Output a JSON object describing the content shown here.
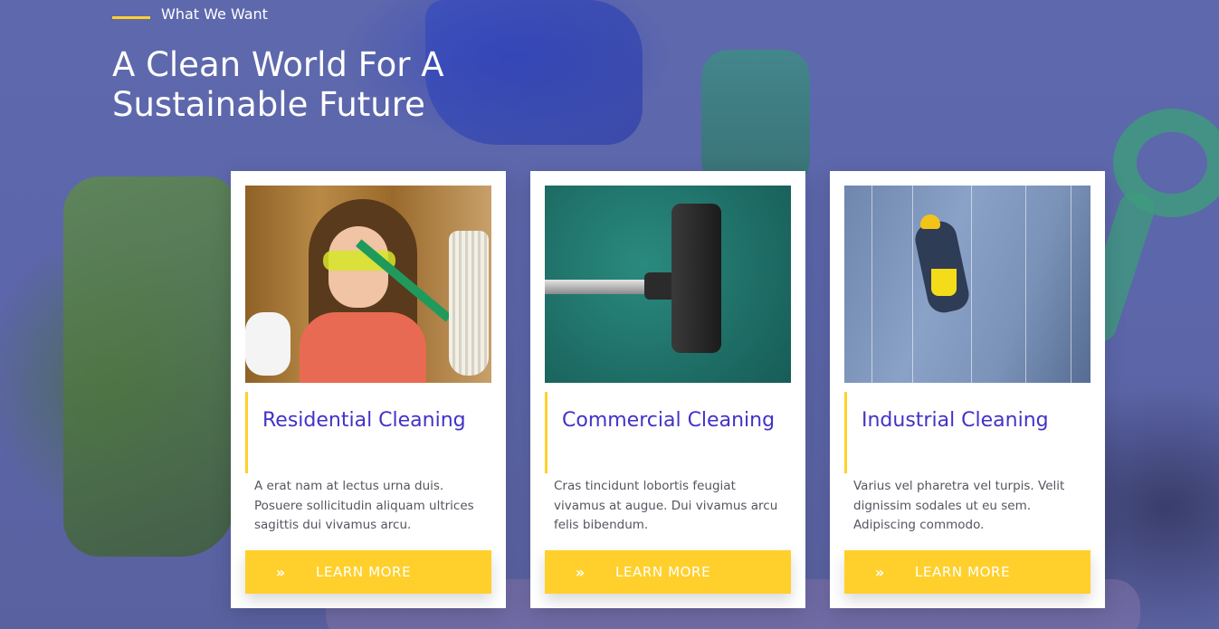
{
  "section": {
    "eyebrow": "What We Want",
    "title": "A Clean World For A Sustainable Future"
  },
  "colors": {
    "accent": "#ffd02c",
    "title_text": "#4232c8",
    "overlay": "#5e68ad"
  },
  "cards": [
    {
      "image": "woman-with-mop-image",
      "title": "Residential Cleaning",
      "description": "A erat nam at lectus urna duis. Posuere sollicitudin aliquam ultrices sagittis dui vivamus arcu.",
      "button_icon": "double-chevron-right-icon",
      "button_label": "LEARN MORE"
    },
    {
      "image": "vacuum-on-carpet-image",
      "title": "Commercial Cleaning",
      "description": "Cras tincidunt lobortis feugiat vivamus at augue. Dui vivamus arcu felis bibendum.",
      "button_icon": "double-chevron-right-icon",
      "button_label": "LEARN MORE"
    },
    {
      "image": "window-cleaner-climber-image",
      "title": "Industrial Cleaning",
      "description": "Varius vel pharetra vel turpis. Velit dignissim sodales ut eu sem. Adipiscing commodo.",
      "button_icon": "double-chevron-right-icon",
      "button_label": "LEARN MORE"
    }
  ]
}
